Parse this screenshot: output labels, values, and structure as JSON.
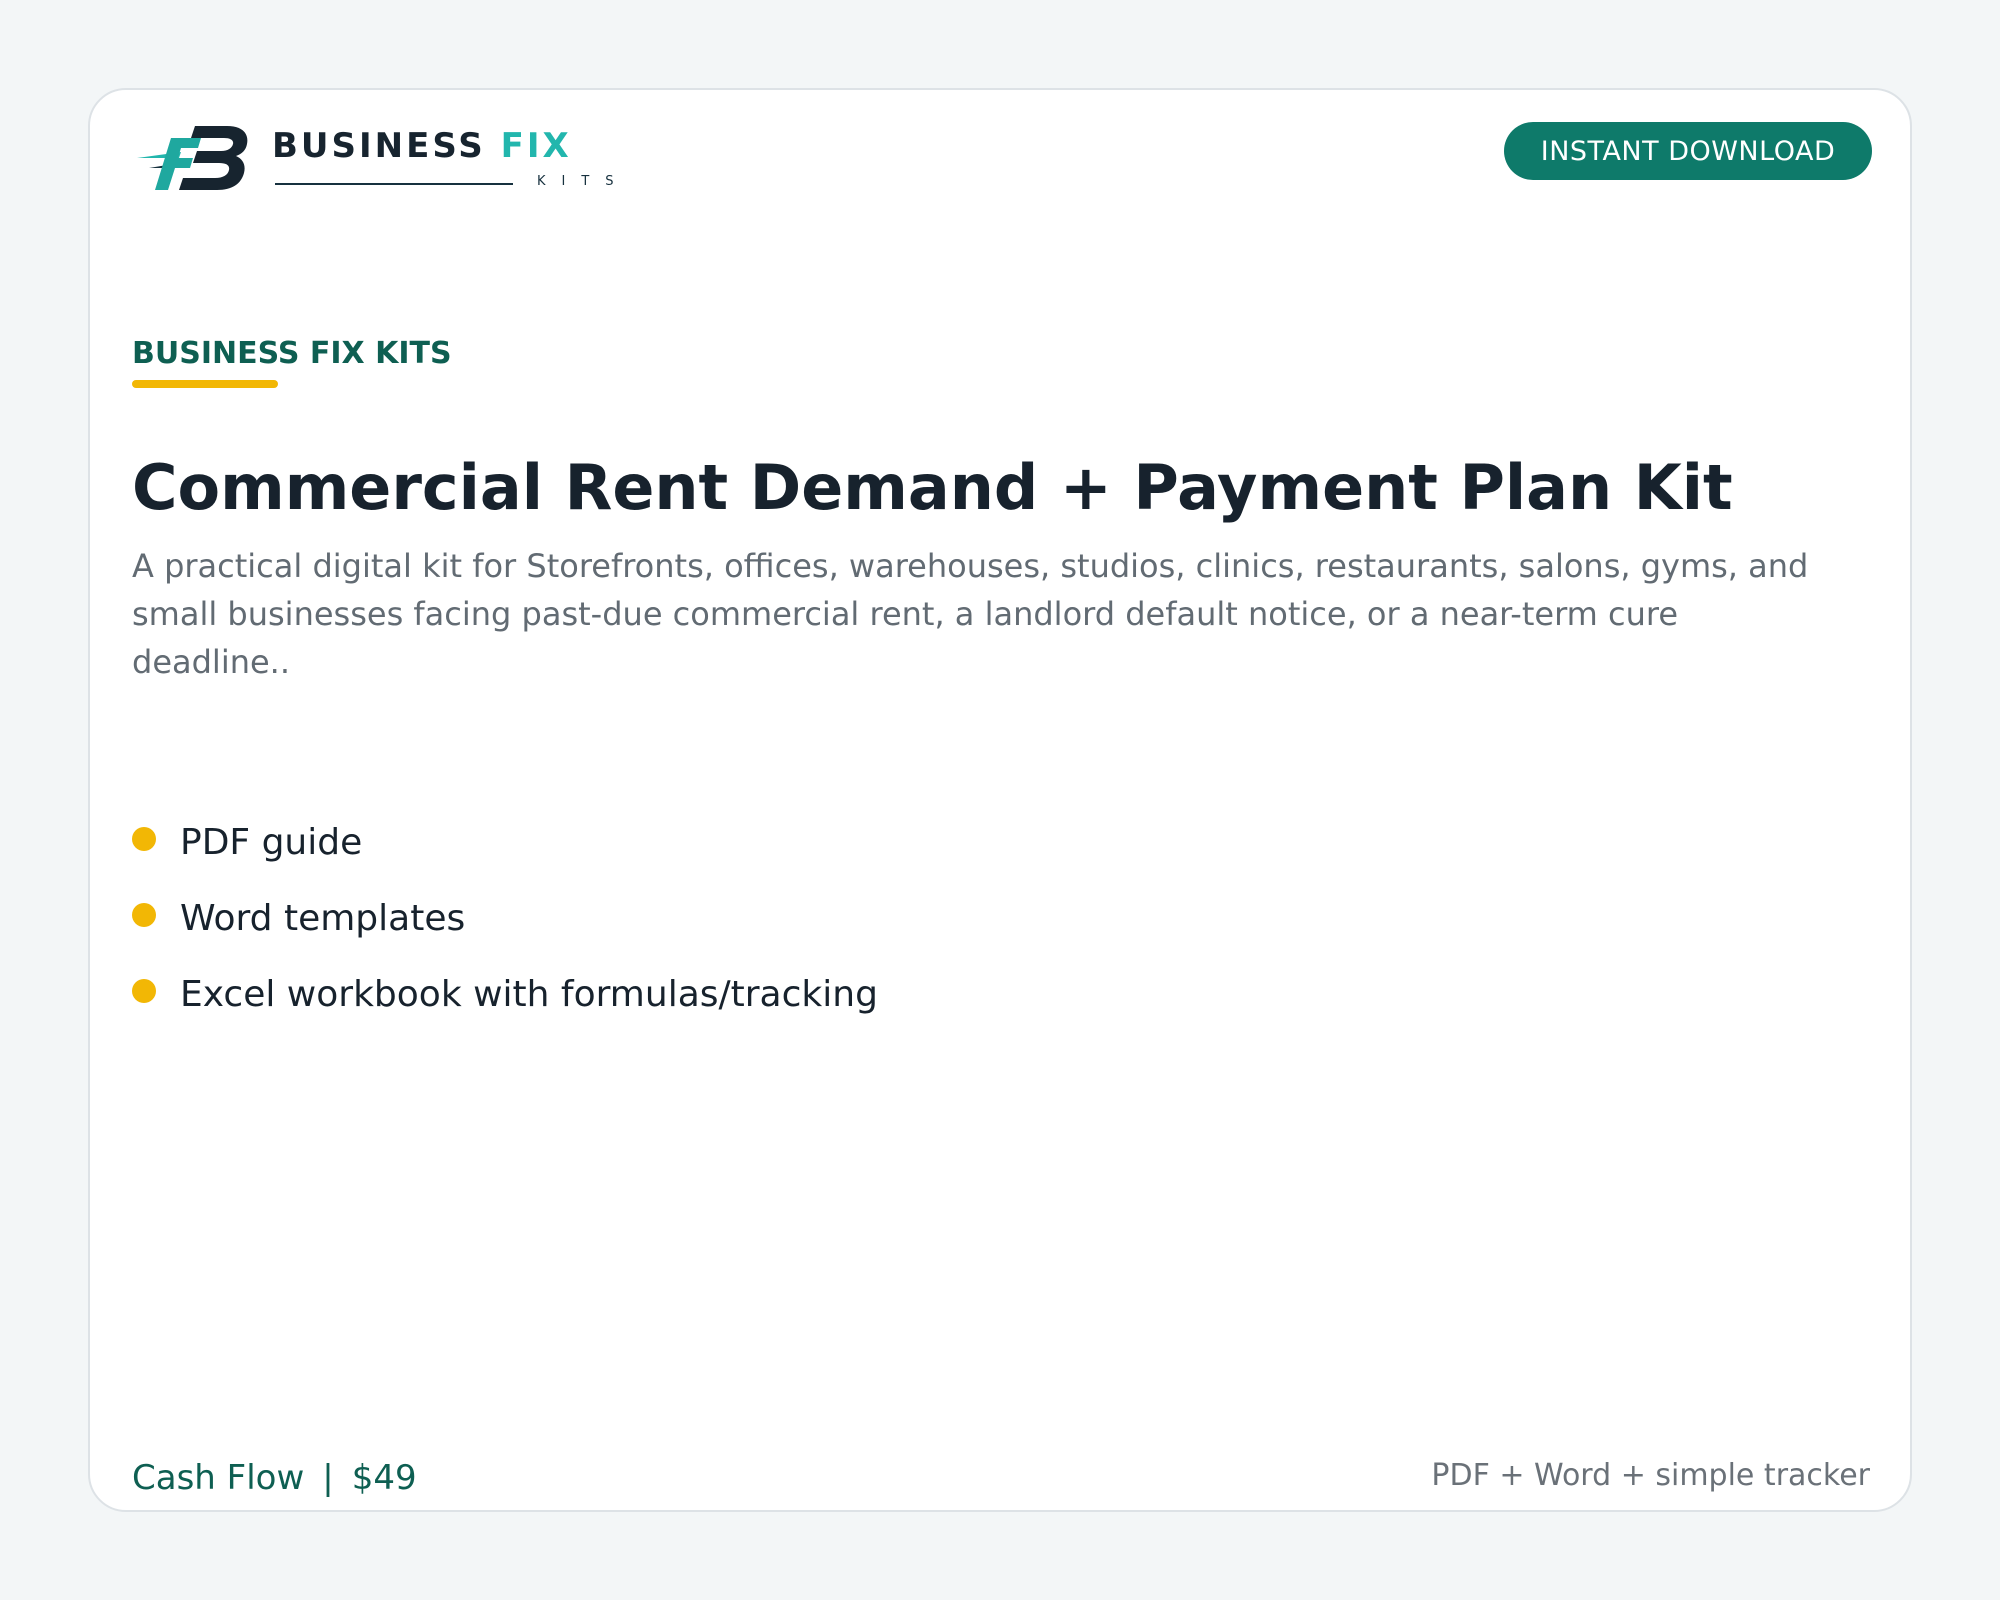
{
  "brand": {
    "name_main": "BUSINESS",
    "name_accent": "FIX",
    "sub": "KITS",
    "colors": {
      "dark": "#17242f",
      "teal": "#22b6ad"
    }
  },
  "badge": {
    "label": "INSTANT DOWNLOAD",
    "color": "#0e7a6a"
  },
  "eyebrow": {
    "label": "BUSINESS FIX KITS",
    "underline_color": "#f2b705"
  },
  "headline": "Commercial Rent Demand + Payment Plan Kit",
  "description": "A practical digital kit for Storefronts, offices, warehouses, studios, clinics, restaurants, salons, gyms, and small businesses facing past-due commercial rent, a landlord default notice, or a near-term cure deadline..",
  "features": [
    {
      "label": "PDF guide"
    },
    {
      "label": "Word templates"
    },
    {
      "label": "Excel workbook with formulas/tracking"
    }
  ],
  "footer": {
    "category": "Cash Flow",
    "separator": "|",
    "price": "$49",
    "formats": "PDF + Word + simple tracker"
  },
  "icons": {
    "bullet": "yellow-dot-icon",
    "logo": "fb-monogram-icon"
  }
}
